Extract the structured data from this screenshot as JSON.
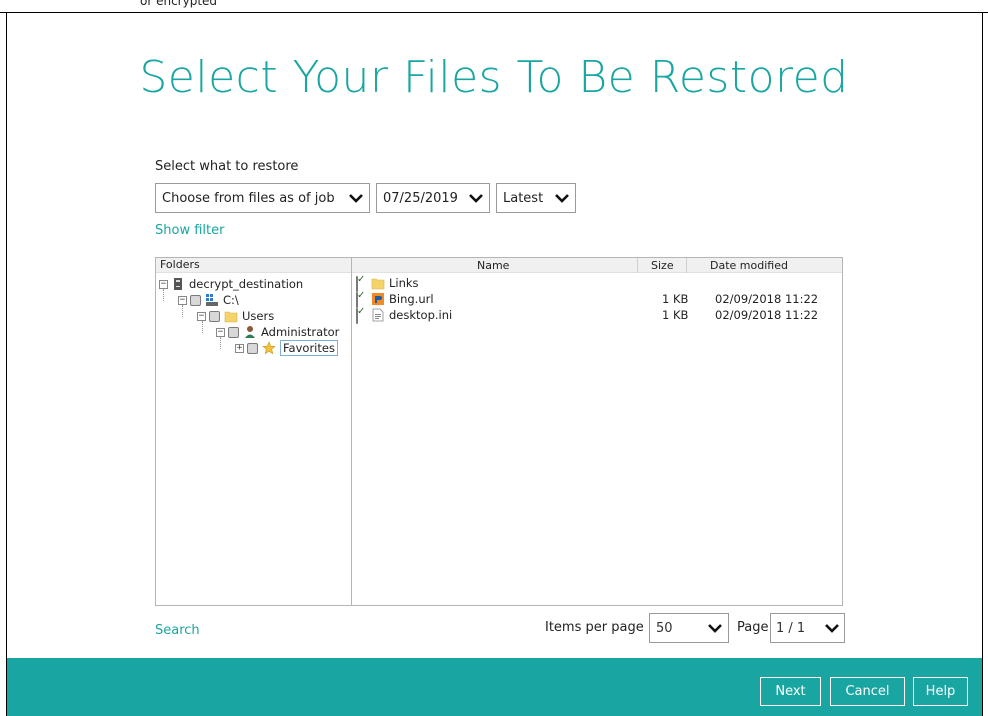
{
  "page": {
    "title": "Select Your Files To Be Restored",
    "top_caption": "or encrypted"
  },
  "restore": {
    "label": "Select what to restore",
    "mode_value": "Choose from files as of job",
    "date_value": "07/25/2019",
    "version_value": "Latest",
    "show_filter": "Show filter"
  },
  "folders": {
    "header": "Folders",
    "tree": [
      {
        "label": "decrypt_destination",
        "icon": "drive-icon"
      },
      {
        "label": "C:\\",
        "icon": "windows-drive-icon"
      },
      {
        "label": "Users",
        "icon": "folder-icon"
      },
      {
        "label": "Administrator",
        "icon": "user-icon"
      },
      {
        "label": "Favorites",
        "icon": "star-icon"
      }
    ]
  },
  "files": {
    "columns": {
      "name": "Name",
      "size": "Size",
      "date": "Date modified"
    },
    "rows": [
      {
        "name": "Links",
        "size": "",
        "date": "",
        "icon": "folder-icon",
        "checked": true
      },
      {
        "name": "Bing.url",
        "size": "1 KB",
        "date": "02/09/2018 11:22",
        "icon": "url-file-icon",
        "checked": true
      },
      {
        "name": "desktop.ini",
        "size": "1 KB",
        "date": "02/09/2018 11:22",
        "icon": "ini-file-icon",
        "checked": true
      }
    ]
  },
  "pager": {
    "search": "Search",
    "items_per_page_label": "Items per page",
    "items_per_page_value": "50",
    "page_label": "Page",
    "page_value": "1 / 1"
  },
  "footer": {
    "next": "Next",
    "cancel": "Cancel",
    "help": "Help"
  },
  "colors": {
    "accent": "#19a6a2"
  }
}
